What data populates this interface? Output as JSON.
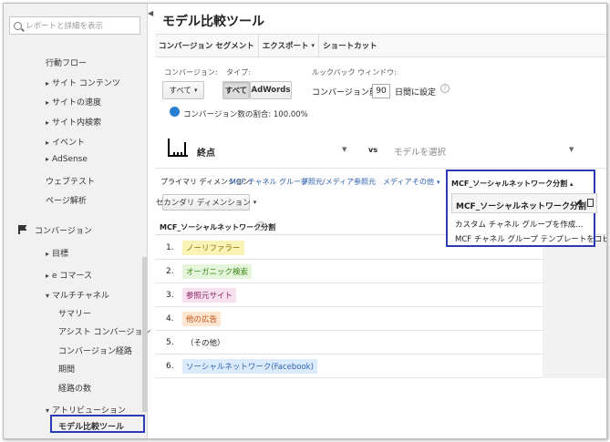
{
  "sidebar": {
    "search_placeholder": "レポートと詳細を表示",
    "items": [
      {
        "label": "行動フロー",
        "level": 0
      },
      {
        "label": "サイト コンテンツ",
        "level": 1,
        "arrow": "right"
      },
      {
        "label": "サイトの速度",
        "level": 1,
        "arrow": "right"
      },
      {
        "label": "サイト内検索",
        "level": 1,
        "arrow": "right"
      },
      {
        "label": "イベント",
        "level": 1,
        "arrow": "right"
      },
      {
        "label": "AdSense",
        "level": 1,
        "arrow": "right"
      },
      {
        "label": "ウェブテスト",
        "level": 0
      },
      {
        "label": "ページ解析",
        "level": 0
      }
    ],
    "section_label": "コンバージョン",
    "conv_items": [
      {
        "label": "目標",
        "arrow": "right"
      },
      {
        "label": "e コマース",
        "arrow": "right"
      },
      {
        "label": "マルチチャネル",
        "arrow": "down"
      }
    ],
    "mcf_items": [
      "サマリー",
      "アシスト コンバージョン",
      "コンバージョン経路",
      "期間",
      "経路の数"
    ],
    "attribution_label": "アトリビューション",
    "selected_label": "モデル比較ツール"
  },
  "main": {
    "title": "モデル比較ツール",
    "toolbar": [
      "コンバージョン セグメント",
      "エクスポート",
      "ショートカット"
    ],
    "conversion_label": "コンバージョン:",
    "conversion_value": "すべて",
    "type_label": "タイプ:",
    "type_all": "すべて",
    "type_adwords": "AdWords",
    "lookback_label": "ルックバック ウィンドウ:",
    "lookback_prefix": "コンバージョン前の",
    "lookback_days": "90",
    "lookback_suffix": "日間に設定",
    "conv_ratio": "コンバージョン数の割合: 100.00%",
    "model_primary": "終点",
    "vs": "vs",
    "model_select": "モデルを選択",
    "primary_dim_label": "プライマリ ディメンション:",
    "primary_dims": [
      "MCF チャネル グループ",
      "参照元/メディア",
      "参照元",
      "メディア",
      "その他"
    ],
    "secondary_dim": "セカンダリ ディメンション",
    "column_header": "MCF_ソーシャルネットワーク分割",
    "dropdown": {
      "header": "MCF_ソーシャルネットワーク分割",
      "selected": "MCF_ソーシャルネットワーク分割",
      "options": [
        "カスタム チャネル グループを作成...",
        "MCF チャネル グループ テンプレートをコピー..."
      ]
    },
    "rows": [
      {
        "idx": "1.",
        "label": "ノーリファラー",
        "bg": "#fbf3b6",
        "fg": "#8a6d00"
      },
      {
        "idx": "2.",
        "label": "オーガニック検索",
        "bg": "#e4f5d9",
        "fg": "#3a8a1e"
      },
      {
        "idx": "3.",
        "label": "参照元サイト",
        "bg": "#f8e1ef",
        "fg": "#8b2763"
      },
      {
        "idx": "4.",
        "label": "他の広告",
        "bg": "#fde5cf",
        "fg": "#c2561b"
      },
      {
        "idx": "5.",
        "label": "（その他）",
        "bg": "#ffffff",
        "fg": "#222222"
      },
      {
        "idx": "6.",
        "label": "ソーシャルネットワーク(Facebook)",
        "bg": "#dcebfb",
        "fg": "#2f63b3"
      }
    ]
  }
}
